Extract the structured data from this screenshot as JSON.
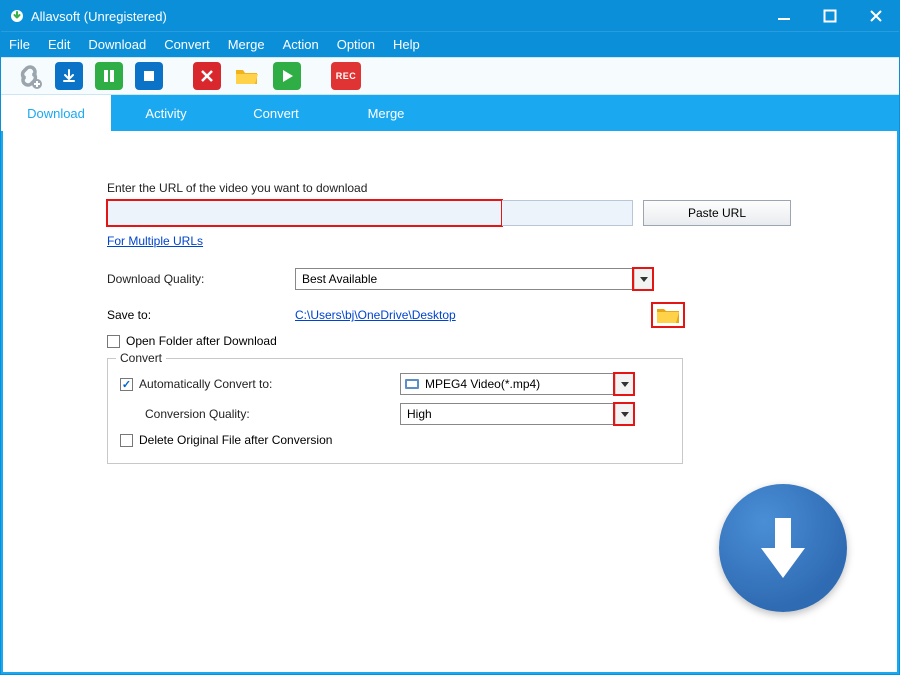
{
  "title": "Allavsoft (Unregistered)",
  "menu": {
    "file": "File",
    "edit": "Edit",
    "download": "Download",
    "convert": "Convert",
    "merge": "Merge",
    "action": "Action",
    "option": "Option",
    "help": "Help"
  },
  "toolbar_icons": {
    "paste": "paste-icon",
    "download": "download-icon",
    "pause": "pause-icon",
    "stop": "stop-icon",
    "delete": "delete-icon",
    "open_folder": "open-folder-icon",
    "play": "play-icon",
    "record": "record-icon"
  },
  "tabs": [
    {
      "id": "download",
      "label": "Download",
      "active": true
    },
    {
      "id": "activity",
      "label": "Activity",
      "active": false
    },
    {
      "id": "convert",
      "label": "Convert",
      "active": false
    },
    {
      "id": "merge",
      "label": "Merge",
      "active": false
    }
  ],
  "main": {
    "url_prompt": "Enter the URL of the video you want to download",
    "url_value": "",
    "paste_url": "Paste URL",
    "multiple_urls": "For Multiple URLs",
    "download_quality_label": "Download Quality:",
    "download_quality_value": "Best Available",
    "save_to_label": "Save to:",
    "save_to_path": "C:\\Users\\bj\\OneDrive\\Desktop",
    "open_folder_after": "Open Folder after Download",
    "open_folder_checked": false,
    "convert_legend": "Convert",
    "auto_convert_label": "Automatically Convert to:",
    "auto_convert_checked": true,
    "auto_convert_value": "MPEG4 Video(*.mp4)",
    "conversion_quality_label": "Conversion Quality:",
    "conversion_quality_value": "High",
    "delete_original_label": "Delete Original File after Conversion",
    "delete_original_checked": false
  }
}
